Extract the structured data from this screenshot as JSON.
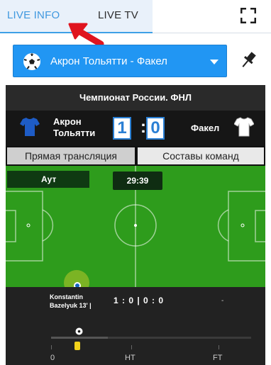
{
  "tabs": {
    "live_info": "LIVE INFO",
    "live_tv": "LIVE TV"
  },
  "match_select": {
    "selected": "Акрон Тольятти - Факел"
  },
  "widget": {
    "league": "Чемпионат России. ФНЛ",
    "home": {
      "name_line1": "Акрон",
      "name_line2": "Тольятти",
      "score": "1"
    },
    "away": {
      "name": "Факел",
      "score": "0"
    },
    "score_separator": ":",
    "subtabs": {
      "live": "Прямая трансляция",
      "lineups": "Составы команд"
    },
    "event": "Аут",
    "clock": "29:39",
    "scorer_line1": "Konstantin",
    "scorer_line2": "Bazelyuk 13' |",
    "scoreline": "1 : 0 | 0 : 0",
    "away_event": "-",
    "timeline": {
      "start": "0",
      "half": "HT",
      "full": "FT"
    }
  },
  "colors": {
    "accent": "#2196f3",
    "pitch": "#2e9c1c",
    "home_jersey": "#1e5cc6",
    "away_jersey": "#ffffff",
    "annotation_arrow": "#e0141e"
  },
  "icons": {
    "expand": "expand-icon",
    "ball": "soccer-ball-icon",
    "pin": "pin-icon",
    "caret": "caret-down-icon"
  }
}
